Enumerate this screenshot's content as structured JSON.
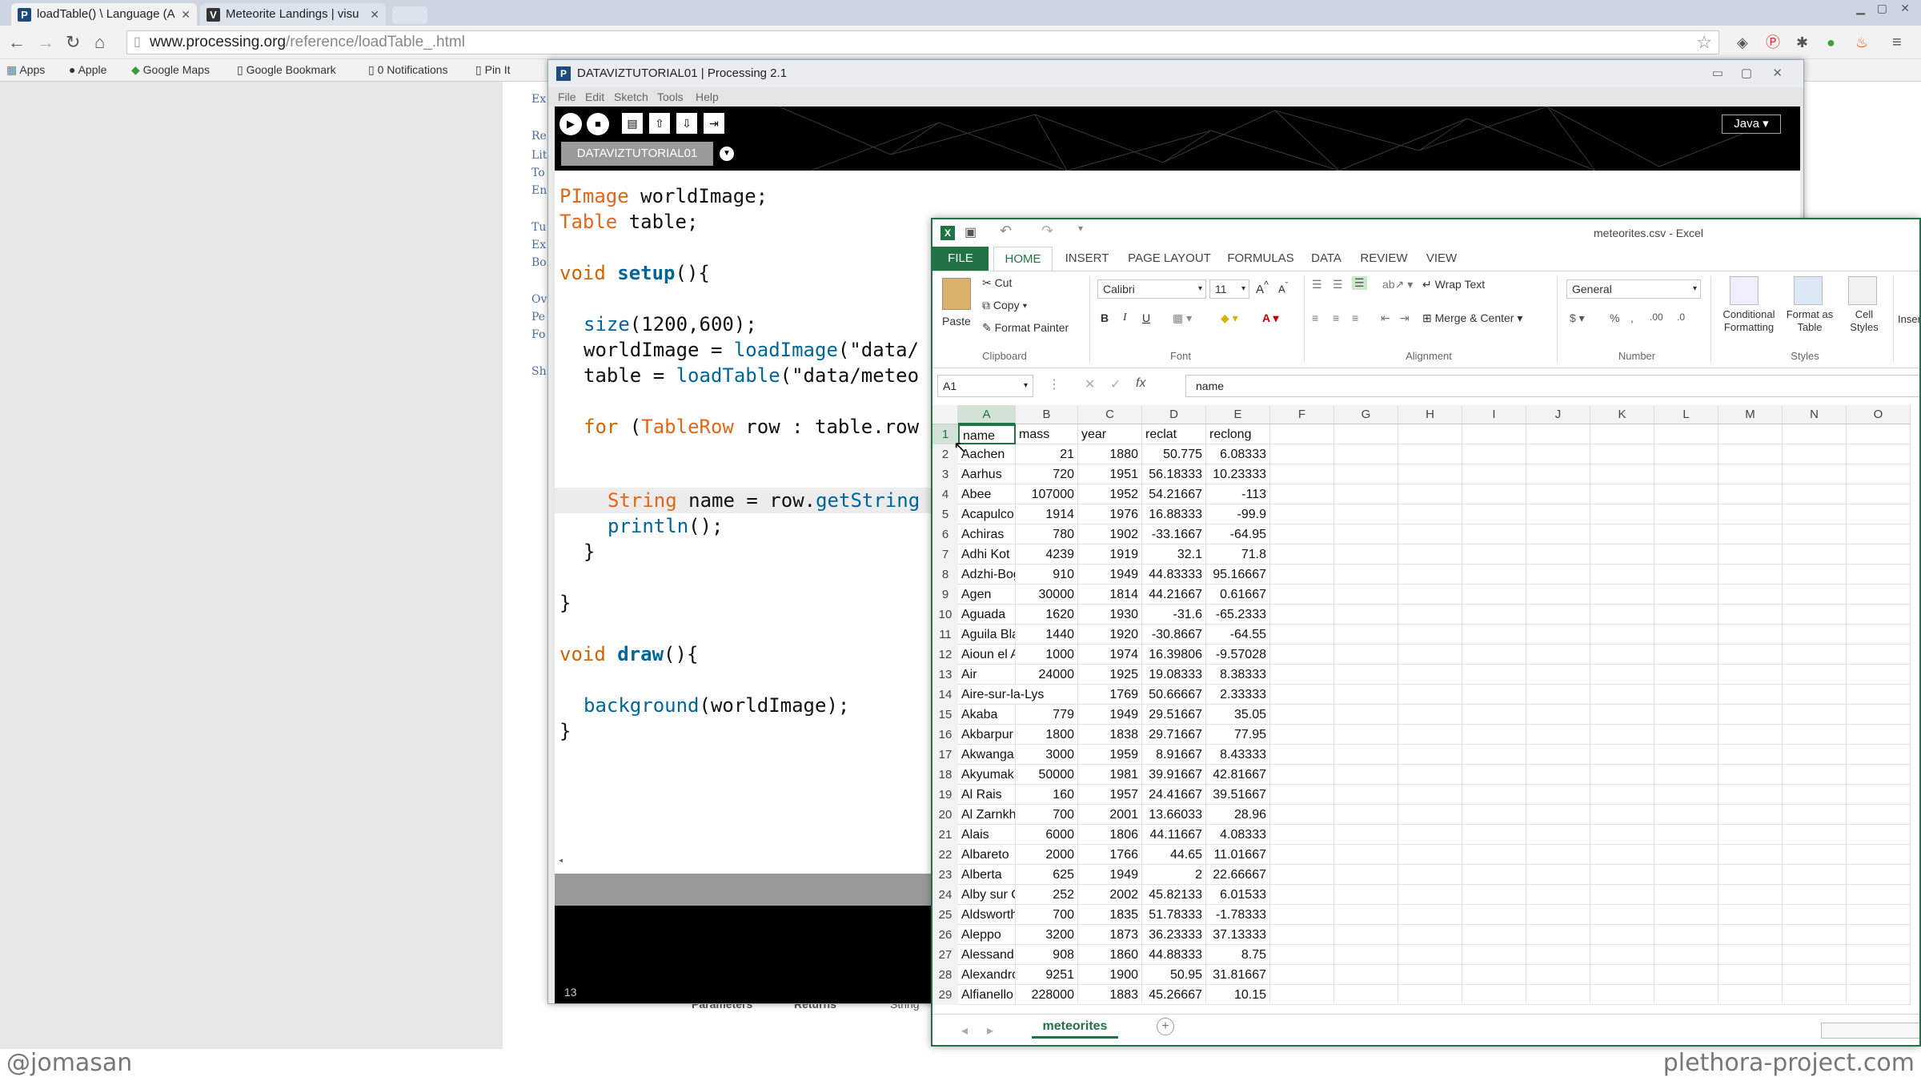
{
  "browser": {
    "tabs": [
      {
        "title": "loadTable() \\ Language (A",
        "favicon": "P"
      },
      {
        "title": "Meteorite Landings | visu",
        "favicon": "V"
      }
    ],
    "url_host": "www.processing.org",
    "url_path": "/reference/loadTable_.html",
    "bookmarks": [
      "Apps",
      "Apple",
      "Google Maps",
      "Google Bookmark",
      "0 Notifications",
      "Pin It"
    ]
  },
  "page_fragments": [
    "Ex",
    "Re",
    "Lit",
    "To",
    "En",
    "Tu",
    "Ex",
    "Bo",
    "Ov",
    "Pe",
    "Fo",
    "Sh",
    "Parameters",
    "Returns",
    "String"
  ],
  "processing": {
    "title": "DATAVIZTUTORIAL01 | Processing 2.1",
    "menu": [
      "File",
      "Edit",
      "Sketch",
      "Tools",
      "Help"
    ],
    "tab": "DATAVIZTUTORIAL01",
    "mode": "Java",
    "status_line": "13",
    "code": {
      "l1_type": "PImage",
      "l1_rest": " worldImage;",
      "l2_type": "Table",
      "l2_rest": " table;",
      "l3_kw": "void",
      "l3_fn": "setup",
      "l3_rest": "(){",
      "l4_fn": "size",
      "l4_rest": "(1200,600);",
      "l5_pre": "worldImage = ",
      "l5_fn": "loadImage",
      "l5_rest": "(\"data/",
      "l6_pre": "table = ",
      "l6_fn": "loadTable",
      "l6_rest": "(\"data/meteo",
      "l7_kw": "for",
      "l7_mid": " (",
      "l7_type": "TableRow",
      "l7_rest": " row : table.row",
      "l8_type": "String",
      "l8_mid": " name = row.",
      "l8_fn": "getString",
      "l9_fn": "println",
      "l9_rest": "();",
      "l10": "}",
      "l11": "}",
      "l12_kw": "void",
      "l12_fn": "draw",
      "l12_rest": "(){",
      "l13_fn": "background",
      "l13_rest": "(worldImage);",
      "l14": "}"
    }
  },
  "excel": {
    "title": "meteorites.csv - Excel",
    "ribbon_tabs": [
      "FILE",
      "HOME",
      "INSERT",
      "PAGE LAYOUT",
      "FORMULAS",
      "DATA",
      "REVIEW",
      "VIEW"
    ],
    "clipboard": {
      "paste": "Paste",
      "cut": "Cut",
      "copy": "Copy",
      "format_painter": "Format Painter",
      "group": "Clipboard"
    },
    "font": {
      "name": "Calibri",
      "size": "11",
      "group": "Font"
    },
    "alignment": {
      "wrap": "Wrap Text",
      "merge": "Merge & Center",
      "group": "Alignment"
    },
    "number": {
      "format": "General",
      "group": "Number"
    },
    "styles": {
      "conditional": "Conditional Formatting",
      "format_table": "Format as Table",
      "cell_styles": "Cell Styles",
      "group": "Styles"
    },
    "insert": "Insert",
    "name_box": "A1",
    "formula": "name",
    "columns": [
      "A",
      "B",
      "C",
      "D",
      "E",
      "F",
      "G",
      "H",
      "I",
      "J",
      "K",
      "L",
      "M",
      "N",
      "O"
    ],
    "header_row": [
      "name",
      "mass",
      "year",
      "reclat",
      "reclong"
    ],
    "rows": [
      [
        "Aachen",
        "21",
        "1880",
        "50.775",
        "6.08333"
      ],
      [
        "Aarhus",
        "720",
        "1951",
        "56.18333",
        "10.23333"
      ],
      [
        "Abee",
        "107000",
        "1952",
        "54.21667",
        "-113"
      ],
      [
        "Acapulco",
        "1914",
        "1976",
        "16.88333",
        "-99.9"
      ],
      [
        "Achiras",
        "780",
        "1902",
        "-33.1667",
        "-64.95"
      ],
      [
        "Adhi Kot",
        "4239",
        "1919",
        "32.1",
        "71.8"
      ],
      [
        "Adzhi-Bog",
        "910",
        "1949",
        "44.83333",
        "95.16667"
      ],
      [
        "Agen",
        "30000",
        "1814",
        "44.21667",
        "0.61667"
      ],
      [
        "Aguada",
        "1620",
        "1930",
        "-31.6",
        "-65.2333"
      ],
      [
        "Aguila Bla",
        "1440",
        "1920",
        "-30.8667",
        "-64.55"
      ],
      [
        "Aioun el A",
        "1000",
        "1974",
        "16.39806",
        "-9.57028"
      ],
      [
        "Air",
        "24000",
        "1925",
        "19.08333",
        "8.38333"
      ],
      [
        "Aire-sur-la-Lys",
        "",
        "1769",
        "50.66667",
        "2.33333"
      ],
      [
        "Akaba",
        "779",
        "1949",
        "29.51667",
        "35.05"
      ],
      [
        "Akbarpur",
        "1800",
        "1838",
        "29.71667",
        "77.95"
      ],
      [
        "Akwanga",
        "3000",
        "1959",
        "8.91667",
        "8.43333"
      ],
      [
        "Akyumak",
        "50000",
        "1981",
        "39.91667",
        "42.81667"
      ],
      [
        "Al Rais",
        "160",
        "1957",
        "24.41667",
        "39.51667"
      ],
      [
        "Al Zarnkh",
        "700",
        "2001",
        "13.66033",
        "28.96"
      ],
      [
        "Alais",
        "6000",
        "1806",
        "44.11667",
        "4.08333"
      ],
      [
        "Albareto",
        "2000",
        "1766",
        "44.65",
        "11.01667"
      ],
      [
        "Alberta",
        "625",
        "1949",
        "2",
        "22.66667"
      ],
      [
        "Alby sur C",
        "252",
        "2002",
        "45.82133",
        "6.01533"
      ],
      [
        "Aldsworth",
        "700",
        "1835",
        "51.78333",
        "-1.78333"
      ],
      [
        "Aleppo",
        "3200",
        "1873",
        "36.23333",
        "37.13333"
      ],
      [
        "Alessandr",
        "908",
        "1860",
        "44.88333",
        "8.75"
      ],
      [
        "Alexandrc",
        "9251",
        "1900",
        "50.95",
        "31.81667"
      ],
      [
        "Alfianello",
        "228000",
        "1883",
        "45.26667",
        "10.15"
      ]
    ],
    "sheet_tab": "meteorites"
  },
  "watermarks": {
    "left": "@jomasan",
    "right": "plethora-project.com"
  }
}
